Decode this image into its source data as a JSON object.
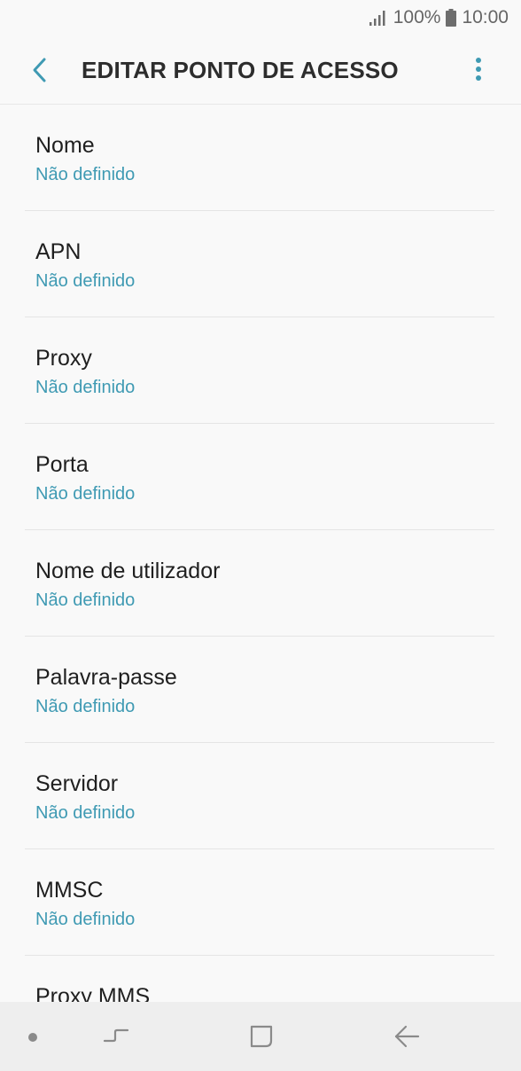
{
  "status": {
    "battery_pct": "100%",
    "time": "10:00",
    "signal_icon": "signal-bars-icon",
    "battery_icon": "battery-full-icon"
  },
  "header": {
    "title": "EDITAR PONTO DE ACESSO",
    "back_icon": "chevron-left-icon",
    "more_icon": "more-vertical-icon"
  },
  "colors": {
    "accent": "#3f9ab3",
    "background": "#f9f9f9",
    "text": "#1f1f1f",
    "nav_background": "#eeeeee"
  },
  "fields": [
    {
      "label": "Nome",
      "value": "Não definido"
    },
    {
      "label": "APN",
      "value": "Não definido"
    },
    {
      "label": "Proxy",
      "value": "Não definido"
    },
    {
      "label": "Porta",
      "value": "Não definido"
    },
    {
      "label": "Nome de utilizador",
      "value": "Não definido"
    },
    {
      "label": "Palavra-passe",
      "value": "Não definido"
    },
    {
      "label": "Servidor",
      "value": "Não definido"
    },
    {
      "label": "MMSC",
      "value": "Não definido"
    },
    {
      "label": "Proxy MMS",
      "value": ""
    }
  ],
  "navbar": {
    "items": [
      "dot-indicator-icon",
      "recent-apps-icon",
      "home-icon",
      "back-icon"
    ]
  }
}
